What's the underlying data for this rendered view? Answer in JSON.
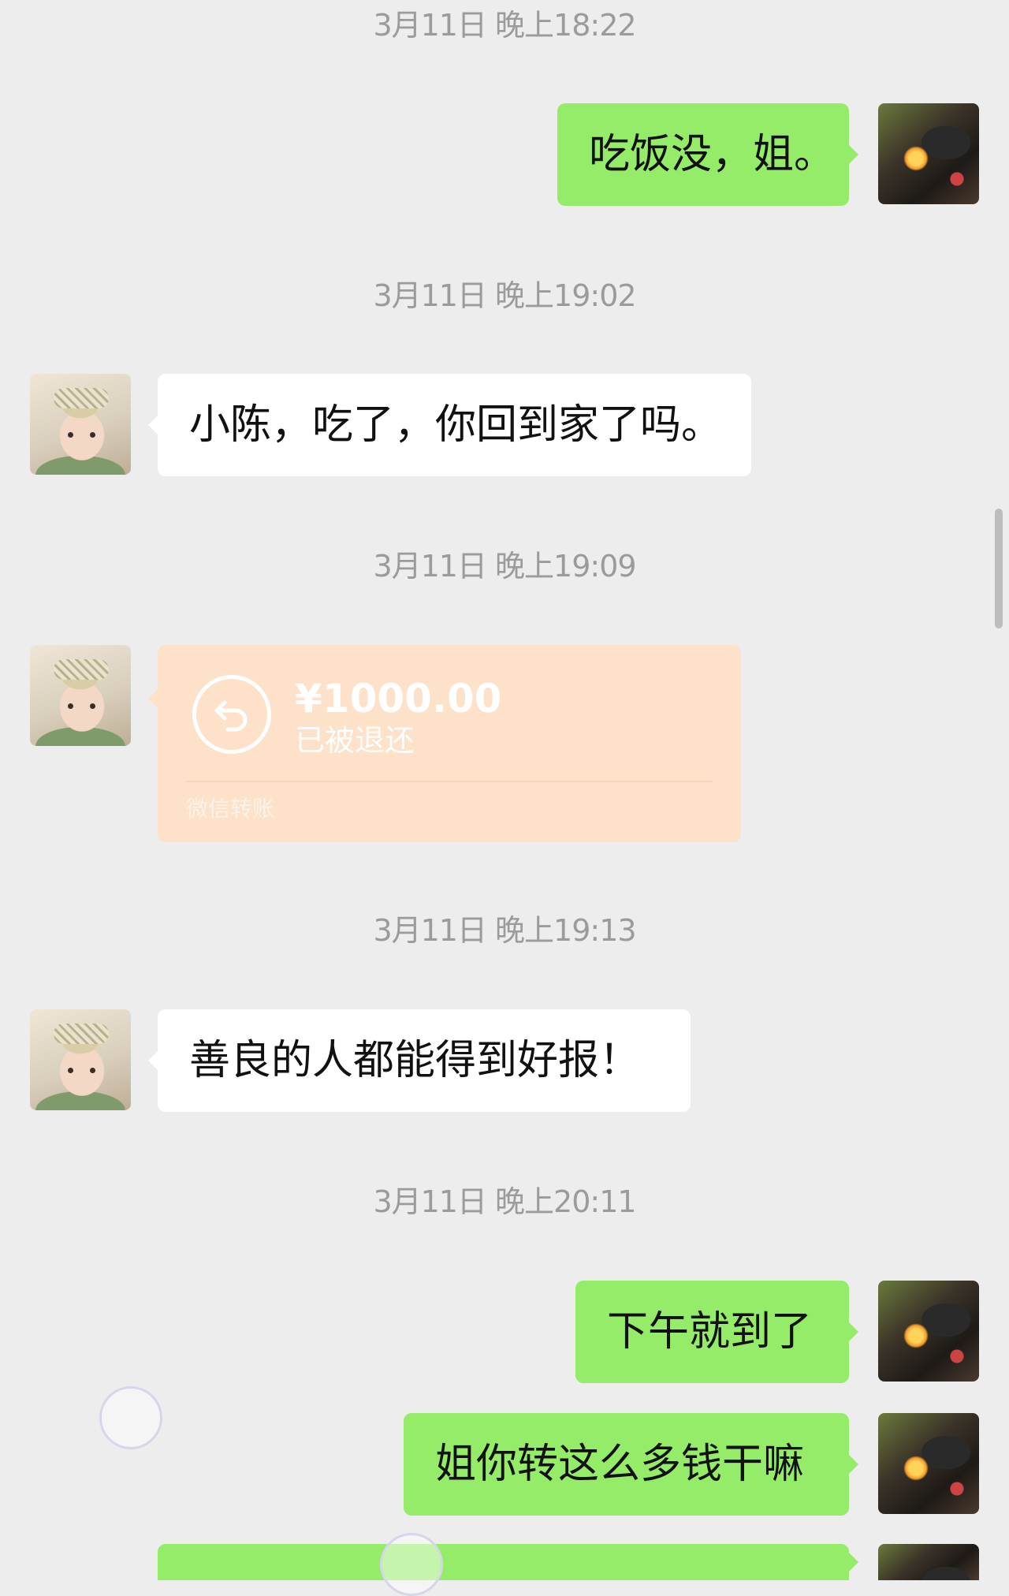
{
  "messages": [
    {
      "type": "time",
      "text": "3月11日 晚上18:22"
    },
    {
      "type": "text",
      "from": "me",
      "text": "吃饭没，姐。"
    },
    {
      "type": "time",
      "text": "3月11日 晚上19:02"
    },
    {
      "type": "text",
      "from": "other",
      "text": "小陈，吃了，你回到家了吗。"
    },
    {
      "type": "time",
      "text": "3月11日 晚上19:09"
    },
    {
      "type": "transfer",
      "from": "other",
      "amount": "¥1000.00",
      "status": "已被退还",
      "brand": "微信转账"
    },
    {
      "type": "time",
      "text": "3月11日 晚上19:13"
    },
    {
      "type": "text",
      "from": "other",
      "text": "善良的人都能得到好报！"
    },
    {
      "type": "time",
      "text": "3月11日 晚上20:11"
    },
    {
      "type": "text",
      "from": "me",
      "text": "下午就到了"
    },
    {
      "type": "text",
      "from": "me",
      "text": "姐你转这么多钱干嘛"
    }
  ],
  "avatars": {
    "me": "soldier-helmet-avatar",
    "other": "baby-headband-avatar"
  },
  "colors": {
    "background": "#ededed",
    "outgoing_bubble": "#95ec69",
    "incoming_bubble": "#ffffff",
    "transfer_returned": "#fde1c8",
    "timestamp": "#9b9b9b"
  }
}
